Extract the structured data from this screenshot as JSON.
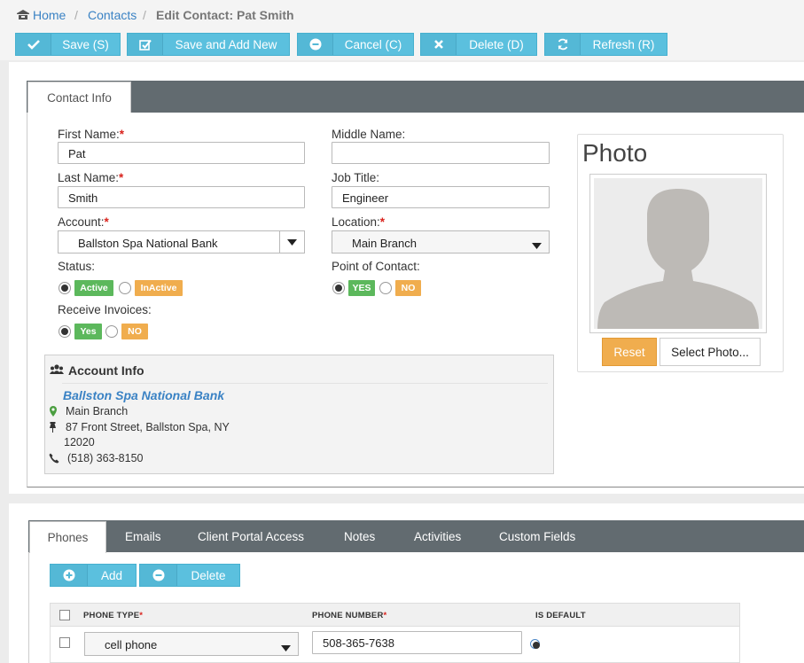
{
  "breadcrumb": {
    "home": "Home",
    "contacts": "Contacts",
    "current": "Edit Contact: Pat Smith",
    "sep": "/"
  },
  "toolbar": {
    "save": "Save (S)",
    "save_add_new": "Save and Add New",
    "cancel": "Cancel (C)",
    "delete": "Delete (D)",
    "refresh": "Refresh (R)"
  },
  "contact_tab": "Contact Info",
  "form": {
    "first_name_label": "First Name:",
    "first_name": "Pat",
    "middle_name_label": "Middle Name:",
    "middle_name": "",
    "last_name_label": "Last Name:",
    "last_name": "Smith",
    "job_title_label": "Job Title:",
    "job_title": "Engineer",
    "account_label": "Account:",
    "account": "Ballston Spa National Bank",
    "location_label": "Location:",
    "location": "Main Branch",
    "status_label": "Status:",
    "status_active": "Active",
    "status_inactive": "InActive",
    "poc_label": "Point of Contact:",
    "poc_yes": "YES",
    "poc_no": "NO",
    "invoices_label": "Receive Invoices:",
    "invoices_yes": "Yes",
    "invoices_no": "NO",
    "required_mark": "*"
  },
  "account_info": {
    "title": "Account Info",
    "name": "Ballston Spa National Bank",
    "branch": "Main Branch",
    "street": "87 Front Street, Ballston Spa, NY",
    "zip": "12020",
    "phone": "(518) 363-8150"
  },
  "photo": {
    "title": "Photo",
    "reset": "Reset",
    "select": "Select Photo..."
  },
  "sub_tabs": [
    "Phones",
    "Emails",
    "Client Portal Access",
    "Notes",
    "Activities",
    "Custom Fields"
  ],
  "phones": {
    "add": "Add",
    "delete": "Delete",
    "headers": {
      "type": "PHONE TYPE",
      "number": "PHONE NUMBER",
      "default": "IS DEFAULT"
    },
    "rows": [
      {
        "type": "cell phone",
        "number": "508-365-7638"
      }
    ]
  },
  "colors": {
    "accent": "#5bc0de",
    "green": "#5cb85c",
    "orange": "#f0ad4e",
    "tabbar": "#626b70",
    "link": "#3a82c4"
  }
}
